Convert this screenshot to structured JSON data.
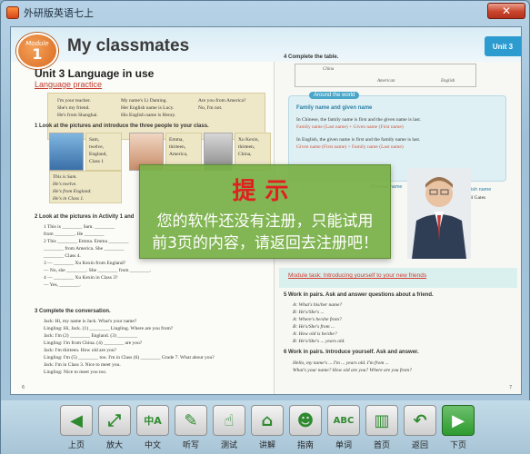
{
  "window": {
    "title": "外研版英语七上",
    "close_label": "✕"
  },
  "book": {
    "module_label": "Module",
    "module_number": "1",
    "module_title": "My classmates",
    "unit_tab": "Unit 3",
    "unit_title": "Unit 3  Language in use",
    "language_practice": "Language practice",
    "grammar": {
      "col1": [
        "I'm your teacher.",
        "She's my friend.",
        "He's from Shanghai."
      ],
      "col2": [
        "My name's Li Daming.",
        "Her English name is Lucy.",
        "His English name is Henry."
      ],
      "col3": [
        "Are you from America?",
        "No, I'm not."
      ]
    },
    "ex1_heading": "1  Look at the pictures and introduce the three people to your class.",
    "sam_card": [
      "Sam,",
      "twelve,",
      "England,",
      "Class 1"
    ],
    "sam_text": [
      "This is Sam.",
      "He's twelve.",
      "He's from England.",
      "He's in Class 1."
    ],
    "emma_card": [
      "Emma,",
      "thirteen,",
      "America,"
    ],
    "xu_card": [
      "Xu Kexin,",
      "thirteen,",
      "China,"
    ],
    "ex2_heading": "2  Look at the pictures in Activity 1 and",
    "ex2_lines": [
      "1  This is ________ Sam. ________",
      "   from ________. He ________",
      "2  This ________ Emma. Emma ________",
      "   ________ from America. She ________",
      "   ________ Class 4.",
      "3  — ________ Xu Kexin from England?",
      "   — No, she ________. She ________ from ________.",
      "4  — ________ Xu Kexin in Class 3?",
      "   — Yes, ________."
    ],
    "ex3_heading": "3  Complete the conversation.",
    "ex3_lines": [
      "Jack: Hi, my name is Jack. What's your name?",
      "Lingling: Hi, Jack. (1) ________ Lingling. Where are you from?",
      "Jack: I'm (2) ________ England. (3) ________",
      "Lingling: I'm from China. (4) ________ are you?",
      "Jack: I'm thirteen. How old are you?",
      "Lingling: I'm (5) ________ too. I'm in Class (6) ________ Grade 7. What about you?",
      "Jack: I'm in Class 3. Nice to meet you.",
      "Lingling: Nice to meet you too."
    ],
    "ex4_heading": "4  Complete the table.",
    "table": [
      "China",
      "American",
      "English"
    ],
    "around_tag": "Around the world",
    "family_heading": "Family name and given name",
    "family_lines": [
      "In Chinese, the family name is first and the given name is last.",
      "Family name (Last name) + Given name (First name)",
      "In English, the given name is first and the family name is last.",
      "Given name (First name) + Family name (Last name)"
    ],
    "chinese_name": "Chinese name",
    "english_name": "English name",
    "bill_gates": "Bill Gates",
    "module_task": "Module task: Introducing yourself to your new friends",
    "ex5_heading": "5  Work in pairs. Ask and answer questions about a friend.",
    "ex5_lines": [
      "A: What's his/her name?",
      "B: He's/She's ...",
      "A: Where's he/she from?",
      "B: He's/She's from ...",
      "A: How old is he/she?",
      "B: He's/She's ... years old."
    ],
    "ex6_heading": "6  Work in pairs. Introduce yourself. Ask and answer.",
    "ex6_lines": [
      "Hello, my name's ...     I'm ... years old.     I'm from ...",
      "What's your name?     How old are you?     Where are you from?"
    ],
    "page_left": "6",
    "page_right": "7"
  },
  "dialog": {
    "title": "提示",
    "message_line1": "您的软件还没有注册，只能试用",
    "message_line2": "前3页的内容，请返回去注册吧！"
  },
  "toolbar": [
    {
      "name": "prev-page",
      "icon": "arrow-left-icon",
      "glyph": "◀",
      "label": "上页"
    },
    {
      "name": "zoom",
      "icon": "expand-icon",
      "glyph": "⤢",
      "label": "放大"
    },
    {
      "name": "chinese",
      "icon": "chinese-icon",
      "glyph": "中A",
      "label": "中文"
    },
    {
      "name": "listen",
      "icon": "write-icon",
      "glyph": "✎",
      "label": "听写"
    },
    {
      "name": "test",
      "icon": "hand-icon",
      "glyph": "☝",
      "label": "测试"
    },
    {
      "name": "explain",
      "icon": "house-icon",
      "glyph": "⌂",
      "label": "讲解"
    },
    {
      "name": "guide",
      "icon": "person-icon",
      "glyph": "☻",
      "label": "指南"
    },
    {
      "name": "words",
      "icon": "abc-icon",
      "glyph": "ABC",
      "label": "单词"
    },
    {
      "name": "home",
      "icon": "book-icon",
      "glyph": "▥",
      "label": "首页"
    },
    {
      "name": "back",
      "icon": "return-icon",
      "glyph": "↶",
      "label": "返回"
    },
    {
      "name": "next-page",
      "icon": "arrow-right-icon",
      "glyph": "▶",
      "label": "下页"
    }
  ]
}
